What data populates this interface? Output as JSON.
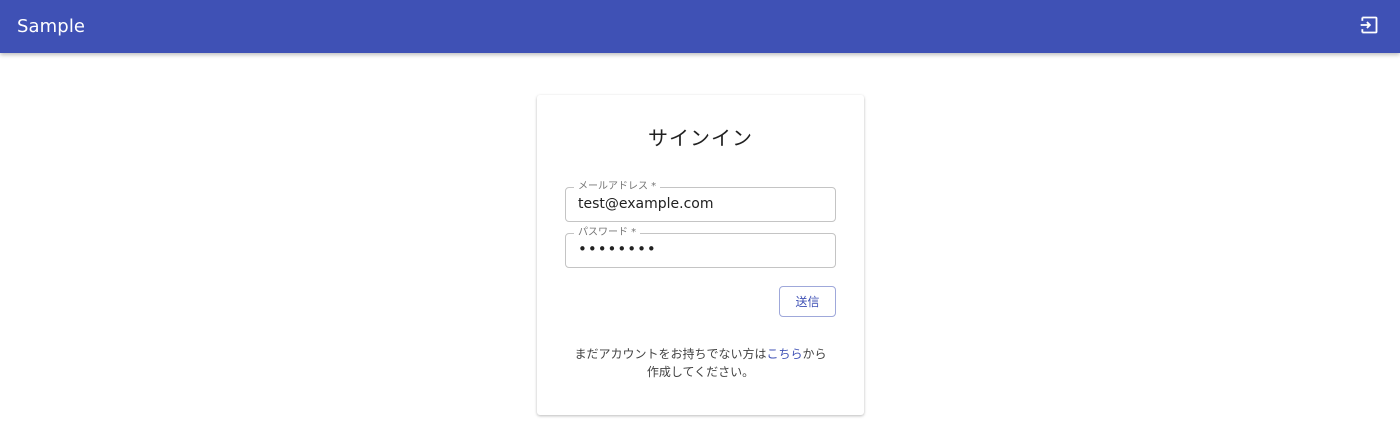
{
  "appbar": {
    "title": "Sample",
    "action_icon": "sign-in-icon"
  },
  "signin": {
    "title": "サインイン",
    "email": {
      "label": "メールアドレス *",
      "value": "test@example.com"
    },
    "password": {
      "label": "パスワード *",
      "value": "••••••••"
    },
    "submit_label": "送信",
    "note": {
      "prefix": "まだアカウントをお持ちでない方は",
      "link": "こちら",
      "suffix_line1": "から",
      "line2": "作成してください。"
    }
  },
  "colors": {
    "appbar": "#3f51b5",
    "accent": "#3f51b5"
  }
}
